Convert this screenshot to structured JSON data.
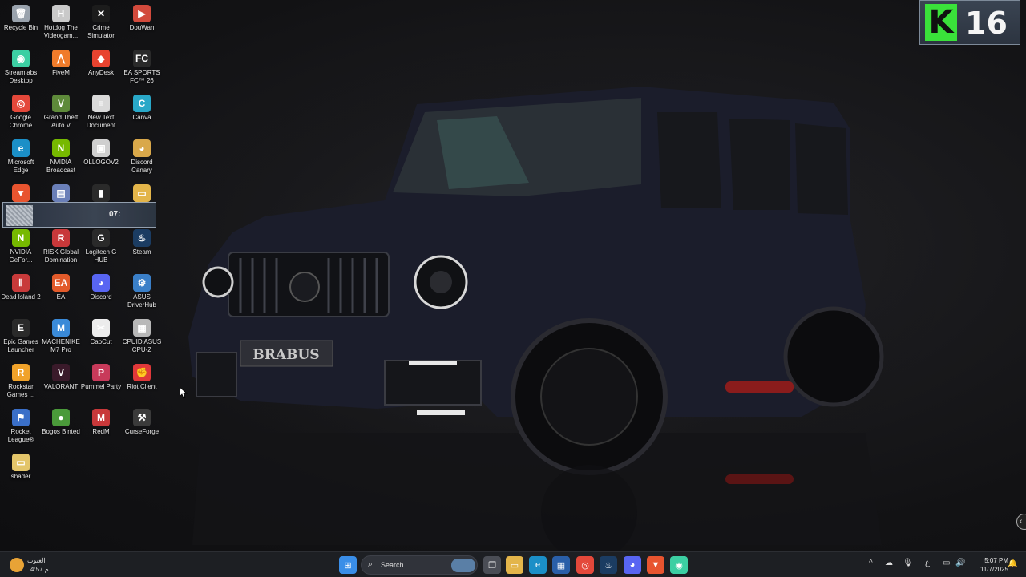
{
  "desktop": {
    "icons": [
      {
        "label": "Recycle Bin",
        "icon": "recycle-bin-icon",
        "color": "#9aa3ad",
        "glyph": "🗑"
      },
      {
        "label": "Hotdog The Videogam...",
        "icon": "hotdog-game-icon",
        "color": "#c9c9c9",
        "glyph": "H"
      },
      {
        "label": "Crime Simulator",
        "icon": "crime-simulator-icon",
        "color": "#1c1c1c",
        "glyph": "✕"
      },
      {
        "label": "DouWan",
        "icon": "douwan-icon",
        "color": "#d24a3c",
        "glyph": "▶"
      },
      {
        "label": "Streamlabs Desktop",
        "icon": "streamlabs-icon",
        "color": "#3ccfa3",
        "glyph": "◉"
      },
      {
        "label": "FiveM",
        "icon": "fivem-icon",
        "color": "#f07b2a",
        "glyph": "⋀"
      },
      {
        "label": "AnyDesk",
        "icon": "anydesk-icon",
        "color": "#e8432f",
        "glyph": "◆"
      },
      {
        "label": "EA SPORTS FC™ 26",
        "icon": "ea-fc-icon",
        "color": "#2a2a2a",
        "glyph": "FC"
      },
      {
        "label": "Google Chrome",
        "icon": "chrome-icon",
        "color": "#e4483a",
        "glyph": "◎"
      },
      {
        "label": "Grand Theft Auto V",
        "icon": "gta-v-icon",
        "color": "#5e8a3a",
        "glyph": "V"
      },
      {
        "label": "New Text Document",
        "icon": "text-document-icon",
        "color": "#d9d9d9",
        "glyph": "≡"
      },
      {
        "label": "Canva",
        "icon": "canva-icon",
        "color": "#29a8c8",
        "glyph": "C"
      },
      {
        "label": "Microsoft Edge",
        "icon": "edge-icon",
        "color": "#1b8fc7",
        "glyph": "e"
      },
      {
        "label": "NVIDIA Broadcast",
        "icon": "nvidia-broadcast-icon",
        "color": "#76b900",
        "glyph": "N"
      },
      {
        "label": "OLLOGOV2",
        "icon": "ollogo-icon",
        "color": "#cfcfcf",
        "glyph": "▣"
      },
      {
        "label": "Discord Canary",
        "icon": "discord-canary-icon",
        "color": "#d9a84a",
        "glyph": "◕"
      },
      {
        "label": "",
        "icon": "brave-icon",
        "color": "#e8542f",
        "glyph": "▼"
      },
      {
        "label": "",
        "icon": "app-icon",
        "color": "#6a7fb8",
        "glyph": "▤"
      },
      {
        "label": "",
        "icon": "app-icon-2",
        "color": "#2a2a2a",
        "glyph": "▮"
      },
      {
        "label": "",
        "icon": "folder-icon",
        "color": "#e3b54a",
        "glyph": "▭"
      },
      {
        "label": "NVIDIA GeFor...",
        "icon": "nvidia-geforce-icon",
        "color": "#76b900",
        "glyph": "N"
      },
      {
        "label": "RISK Global Domination",
        "icon": "risk-icon",
        "color": "#c8383a",
        "glyph": "R"
      },
      {
        "label": "Logitech G HUB",
        "icon": "logitech-icon",
        "color": "#2a2a2a",
        "glyph": "G"
      },
      {
        "label": "Steam",
        "icon": "steam-icon",
        "color": "#1b3c62",
        "glyph": "♨"
      },
      {
        "label": "Dead Island 2",
        "icon": "dead-island-icon",
        "color": "#c83a3a",
        "glyph": "Ⅱ"
      },
      {
        "label": "EA",
        "icon": "ea-icon",
        "color": "#e25a2a",
        "glyph": "EA"
      },
      {
        "label": "Discord",
        "icon": "discord-icon",
        "color": "#5865f2",
        "glyph": "◕"
      },
      {
        "label": "ASUS DriverHub",
        "icon": "asus-driverhub-icon",
        "color": "#3a7fc8",
        "glyph": "⚙"
      },
      {
        "label": "Epic Games Launcher",
        "icon": "epic-games-icon",
        "color": "#2a2a2a",
        "glyph": "E"
      },
      {
        "label": "MACHENIKE M7 Pro",
        "icon": "machenike-icon",
        "color": "#3a8ad8",
        "glyph": "M"
      },
      {
        "label": "CapCut",
        "icon": "capcut-icon",
        "color": "#ececec",
        "glyph": "✂"
      },
      {
        "label": "CPUID ASUS CPU-Z",
        "icon": "cpuz-icon",
        "color": "#b8b8b8",
        "glyph": "▦"
      },
      {
        "label": "Rockstar Games ...",
        "icon": "rockstar-icon",
        "color": "#f0a22a",
        "glyph": "R"
      },
      {
        "label": "VALORANT",
        "icon": "valorant-icon",
        "color": "#3a1a2a",
        "glyph": "V"
      },
      {
        "label": "Pummel Party",
        "icon": "pummel-party-icon",
        "color": "#c83a5a",
        "glyph": "P"
      },
      {
        "label": "Riot Client",
        "icon": "riot-client-icon",
        "color": "#e0383a",
        "glyph": "✊"
      },
      {
        "label": "Rocket League®",
        "icon": "rocket-league-icon",
        "color": "#3a6fc8",
        "glyph": "⚑"
      },
      {
        "label": "Bogos Binted",
        "icon": "bogos-binted-icon",
        "color": "#4a9a3a",
        "glyph": "●"
      },
      {
        "label": "RedM",
        "icon": "redm-icon",
        "color": "#c8383a",
        "glyph": "M"
      },
      {
        "label": "CurseForge",
        "icon": "curseforge-icon",
        "color": "#3a3a3a",
        "glyph": "⚒"
      },
      {
        "label": "shader",
        "icon": "folder-icon",
        "color": "#e3c56a",
        "glyph": "▭"
      }
    ],
    "widget_time": "07:",
    "badge": {
      "letter": "K",
      "number": "16",
      "color": "#3ae13a"
    },
    "wallpaper_text": "BRABUS"
  },
  "taskbar": {
    "weather": {
      "line1": "الغيوب",
      "line2": "4:57 م"
    },
    "search_placeholder": "Search",
    "apps": [
      {
        "icon": "windows-start-icon",
        "color": "#3a8ee8",
        "glyph": "⊞"
      },
      {
        "icon": "task-view-icon",
        "color": "#4a4d55",
        "glyph": "❐"
      },
      {
        "icon": "file-explorer-icon",
        "color": "#e3b54a",
        "glyph": "▭"
      },
      {
        "icon": "edge-icon",
        "color": "#1b8fc7",
        "glyph": "e"
      },
      {
        "icon": "store-icon",
        "color": "#2a5fa8",
        "glyph": "▦"
      },
      {
        "icon": "chrome-icon",
        "color": "#e4483a",
        "glyph": "◎"
      },
      {
        "icon": "steam-icon",
        "color": "#1b3c62",
        "glyph": "♨"
      },
      {
        "icon": "discord-icon",
        "color": "#5865f2",
        "glyph": "◕"
      },
      {
        "icon": "brave-icon",
        "color": "#e8542f",
        "glyph": "▼"
      },
      {
        "icon": "streamlabs-icon",
        "color": "#3ccfa3",
        "glyph": "◉"
      }
    ],
    "tray": {
      "chevron": "^",
      "language": "ع",
      "time": "5:07 PM",
      "date": "11/7/2025"
    }
  }
}
